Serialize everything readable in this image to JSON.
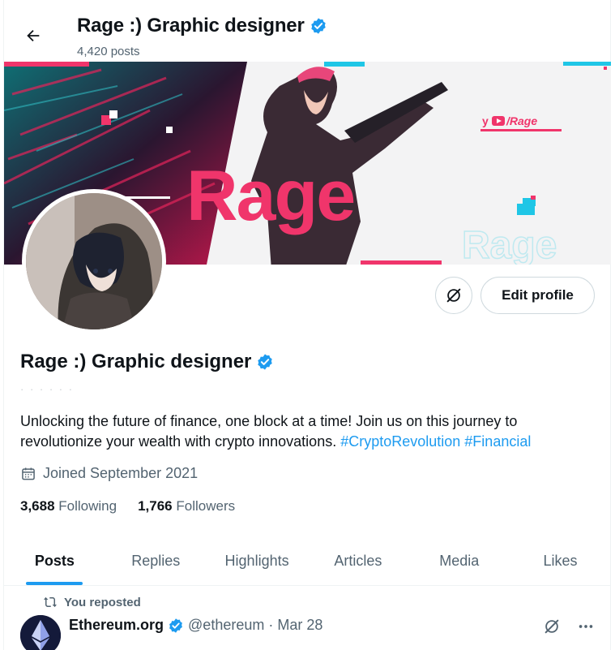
{
  "header": {
    "title": "Rage :) Graphic designer",
    "posts_count": "4,420 posts"
  },
  "banner": {
    "headline": "Rage",
    "watermark": "Rage",
    "social_handle": "/Rage"
  },
  "profile": {
    "name": "Rage :) Graphic designer",
    "handle": "· · · · · ·",
    "bio_text": "Unlocking the future of finance, one block at a time! Join us on this journey to revolutionize your wealth with crypto innovations. ",
    "hashtags": [
      "#CryptoRevolution",
      "#Financial"
    ],
    "joined": "Joined September 2021",
    "following_count": "3,688",
    "following_label": "Following",
    "followers_count": "1,766",
    "followers_label": "Followers",
    "edit_label": "Edit profile"
  },
  "tabs": [
    {
      "label": "Posts"
    },
    {
      "label": "Replies"
    },
    {
      "label": "Highlights"
    },
    {
      "label": "Articles"
    },
    {
      "label": "Media"
    },
    {
      "label": "Likes"
    }
  ],
  "post": {
    "repost_label": "You reposted",
    "author": "Ethereum.org",
    "author_handle": "@ethereum",
    "separator": "·",
    "date": "Mar 28"
  },
  "colors": {
    "accent": "#1d9bf0",
    "banner_pink": "#f0356b",
    "banner_cyan": "#1fc6e6",
    "text_secondary": "#536471"
  },
  "icons": {
    "back": "arrow-left-icon",
    "verified": "verified-badge-icon",
    "grok": "grok-icon",
    "calendar": "calendar-icon",
    "repost": "repost-icon",
    "more": "more-dots-icon"
  }
}
